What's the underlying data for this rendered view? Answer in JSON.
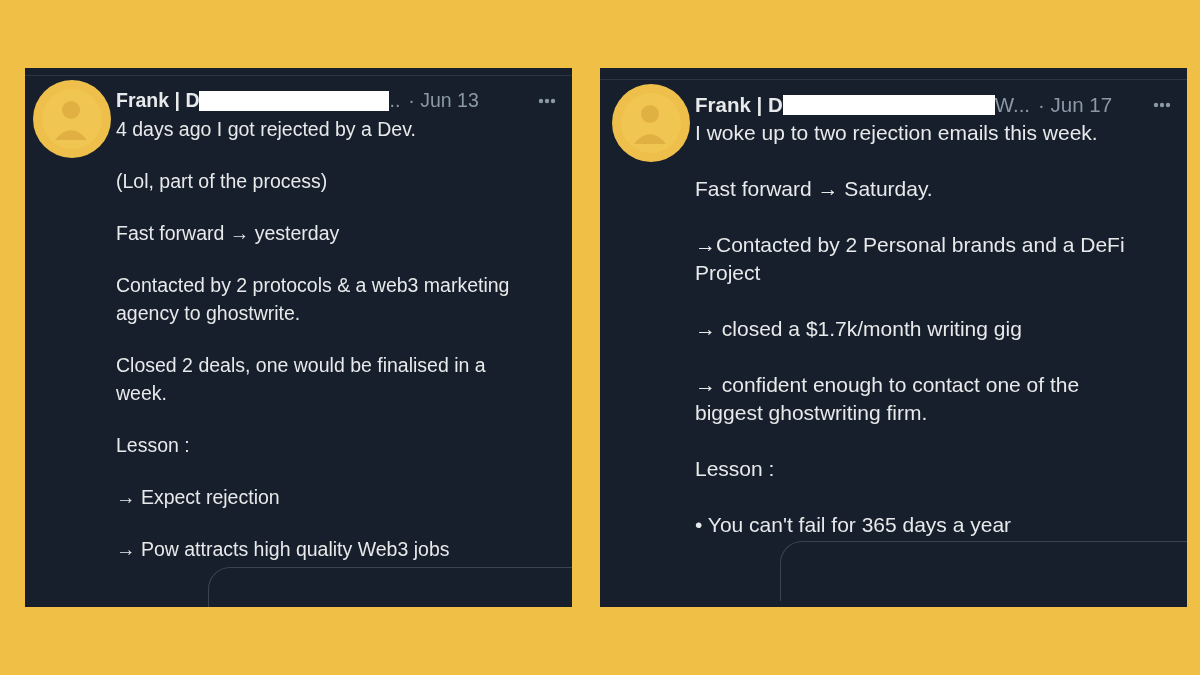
{
  "posts": [
    {
      "author": "Frank | D",
      "handle_tail": "..",
      "date": "· Jun 13",
      "paragraphs": [
        "4 days ago I got rejected by a Dev.",
        "(Lol, part of the process)",
        "Fast forward → yesterday",
        "Contacted by 2 protocols & a web3 marketing\nagency to ghostwrite.",
        "Closed 2 deals, one would be finalised in a\nweek.",
        "Lesson :",
        "→ Expect rejection",
        "→ Pow attracts high quality Web3 jobs"
      ]
    },
    {
      "author": "Frank | D",
      "handle_tail": "W...",
      "date": "· Jun 17",
      "paragraphs": [
        "I woke up to two rejection emails this week.",
        "Fast forward → Saturday.",
        "→Contacted by 2 Personal brands and a DeFi\nProject",
        "→ closed a $1.7k/month writing gig",
        "→ confident enough to contact one of the\nbiggest ghostwriting firm.",
        "Lesson :",
        "• You can't fail for 365 days a year"
      ]
    }
  ]
}
